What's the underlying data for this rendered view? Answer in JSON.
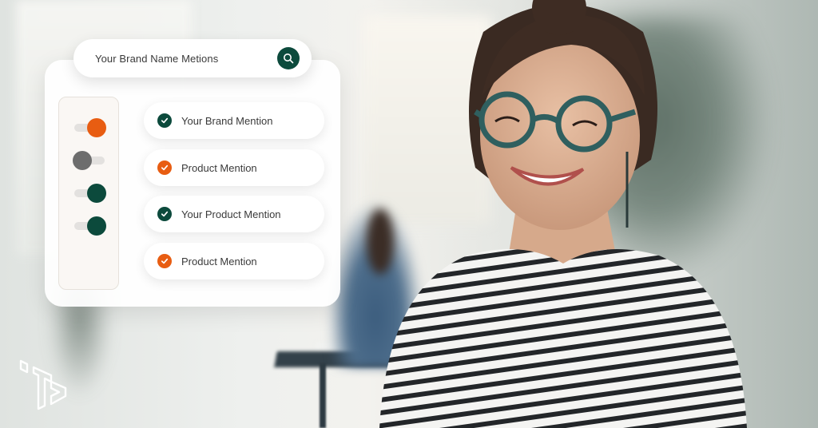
{
  "search": {
    "text": "Your Brand Name Metions",
    "icon": "search-icon"
  },
  "colors": {
    "green": "#0c4a3c",
    "orange": "#e85d12",
    "gray": "#6d6d6d",
    "track": "#e3e1df"
  },
  "toggles": [
    {
      "state": "on",
      "color": "#e85d12"
    },
    {
      "state": "off",
      "color": "#6d6d6d"
    },
    {
      "state": "on",
      "color": "#0c4a3c"
    },
    {
      "state": "on",
      "color": "#0c4a3c"
    }
  ],
  "mentions": [
    {
      "label": "Your Brand Mention",
      "color": "#0c4a3c",
      "icon": "check-icon"
    },
    {
      "label": "Product Mention",
      "color": "#e85d12",
      "icon": "check-icon"
    },
    {
      "label": "Your Product Mention",
      "color": "#0c4a3c",
      "icon": "check-icon"
    },
    {
      "label": "Product Mention",
      "color": "#e85d12",
      "icon": "check-icon"
    }
  ],
  "logo": {
    "icon": "brand-logo-icon"
  }
}
